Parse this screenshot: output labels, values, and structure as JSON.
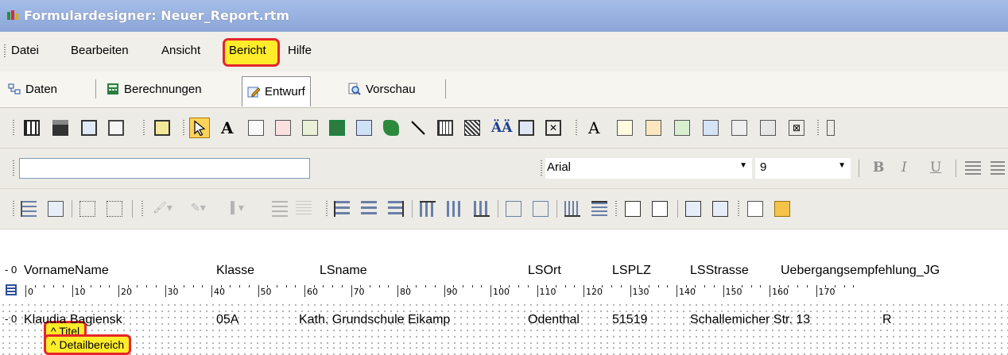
{
  "window": {
    "title": "Formulardesigner: Neuer_Report.rtm"
  },
  "menu": {
    "items": [
      "Datei",
      "Bearbeiten",
      "Ansicht",
      "Bericht",
      "Hilfe"
    ],
    "highlighted": "Bericht"
  },
  "tabs": [
    {
      "label": "Daten",
      "icon": "data-icon"
    },
    {
      "label": "Berechnungen",
      "icon": "calc-icon"
    },
    {
      "label": "Entwurf",
      "icon": "design-icon",
      "active": true
    },
    {
      "label": "Vorschau",
      "icon": "preview-icon"
    }
  ],
  "format_toolbar": {
    "edit_value": "",
    "font": "Arial",
    "font_size": "9",
    "bold": "B",
    "italic": "I",
    "underline": "U"
  },
  "ruler": {
    "labels": [
      "0",
      "10",
      "20",
      "30",
      "40",
      "50",
      "60",
      "70",
      "80",
      "90",
      "100",
      "110",
      "120",
      "130",
      "140",
      "150",
      "160",
      "170"
    ]
  },
  "title_band": {
    "marker": "- 0",
    "fields": [
      "VornameName",
      "Klasse",
      "LSname",
      "LSOrt",
      "LSPLZ",
      "LSStrasse",
      "Uebergangsempfehlung_JG"
    ],
    "label": "^ Titel"
  },
  "detail_band": {
    "marker": "- 0",
    "fields": [
      "Klaudia Bagiensk",
      "05A",
      "Kath. Grundschule Eikamp",
      "Odenthal",
      "51519",
      "Schallemicher Str. 13",
      "R"
    ],
    "label": "^ Detailbereich"
  },
  "colors": {
    "highlight_fill": "#ffec2b",
    "highlight_border": "#e4262b",
    "titlebar": "#8ba6d8"
  }
}
